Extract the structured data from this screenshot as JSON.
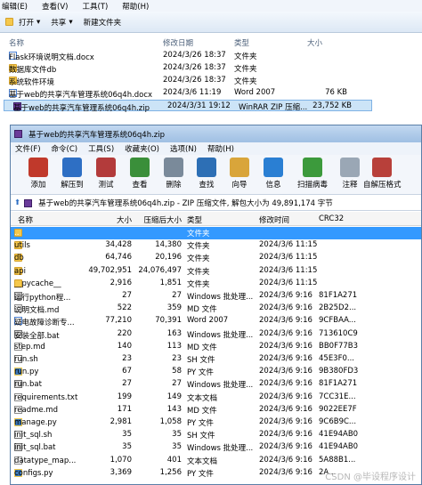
{
  "explorer": {
    "menu": [
      "编辑(E)",
      "查看(V)",
      "工具(T)",
      "帮助(H)"
    ],
    "toolbar": {
      "open": "打开",
      "share": "共享",
      "new_folder": "新建文件夹"
    },
    "columns": {
      "name": "名称",
      "modified": "修改日期",
      "type": "类型",
      "size": "大小"
    },
    "files": [
      {
        "name": "Flask环境说明文档.docx",
        "icon": "doc",
        "modified": "2024/3/26 18:37",
        "type": "文件夹",
        "size": ""
      },
      {
        "name": "数据库文件db",
        "icon": "folder",
        "modified": "2024/3/26 18:37",
        "type": "文件夹",
        "size": ""
      },
      {
        "name": "系统软件环境",
        "icon": "folder",
        "modified": "2024/3/26 18:37",
        "type": "文件夹",
        "size": ""
      },
      {
        "name": "基于web的共享汽车管理系统06q4h.docx",
        "icon": "doc",
        "modified": "2024/3/6 11:19",
        "type": "Word 2007",
        "size": "76 KB"
      },
      {
        "name": "基于web的共享汽车管理系统06q4h.zip",
        "icon": "zip",
        "modified": "2024/3/31 19:12",
        "type": "WinRAR ZIP 压缩...",
        "size": "23,752 KB",
        "selected": true
      }
    ]
  },
  "winrar": {
    "title": "基于web的共享汽车管理系统06q4h.zip",
    "menu": [
      "文件(F)",
      "命令(C)",
      "工具(S)",
      "收藏夹(O)",
      "选项(N)",
      "帮助(H)"
    ],
    "toolbar": [
      {
        "label": "添加",
        "icon": "add-icon",
        "color": "#c0392b"
      },
      {
        "label": "解压到",
        "icon": "extract-icon",
        "color": "#2e6fc4"
      },
      {
        "label": "测试",
        "icon": "test-icon",
        "color": "#b33b3b"
      },
      {
        "label": "查看",
        "icon": "view-icon",
        "color": "#3a8f3a"
      },
      {
        "label": "删除",
        "icon": "delete-icon",
        "color": "#7a8a9a"
      },
      {
        "label": "查找",
        "icon": "find-icon",
        "color": "#2d6fb5"
      },
      {
        "label": "向导",
        "icon": "wizard-icon",
        "color": "#d9a53a"
      },
      {
        "label": "信息",
        "icon": "info-icon",
        "color": "#2a7fd3"
      },
      {
        "label": "扫描病毒",
        "icon": "virus-scan-icon",
        "color": "#3c9a3c"
      },
      {
        "label": "注释",
        "icon": "comment-icon",
        "color": "#9aa7b5"
      },
      {
        "label": "自解压格式",
        "icon": "sfx-icon",
        "color": "#b8403a"
      }
    ],
    "path": "基于web的共享汽车管理系统06q4h.zip - ZIP 压缩文件, 解包大小为 49,891,174 字节",
    "columns": {
      "name": "名称",
      "size": "大小",
      "packed": "压缩后大小",
      "type": "类型",
      "modified": "修改时间",
      "crc": "CRC32"
    },
    "files": [
      {
        "name": "..",
        "icon": "folder",
        "size": "",
        "packed": "",
        "type": "文件夹",
        "modified": "",
        "crc": "",
        "selected": true
      },
      {
        "name": "utils",
        "icon": "folder",
        "size": "34,428",
        "packed": "14,380",
        "type": "文件夹",
        "modified": "2024/3/6 11:15",
        "crc": ""
      },
      {
        "name": "db",
        "icon": "folder",
        "size": "64,746",
        "packed": "20,196",
        "type": "文件夹",
        "modified": "2024/3/6 11:15",
        "crc": ""
      },
      {
        "name": "api",
        "icon": "folder",
        "size": "49,702,951",
        "packed": "24,076,497",
        "type": "文件夹",
        "modified": "2024/3/6 11:15",
        "crc": ""
      },
      {
        "name": "__pycache__",
        "icon": "folder",
        "size": "2,916",
        "packed": "1,851",
        "type": "文件夹",
        "modified": "2024/3/6 11:15",
        "crc": ""
      },
      {
        "name": "运行python程...",
        "icon": "bat",
        "size": "27",
        "packed": "27",
        "type": "Windows 批处理...",
        "modified": "2024/3/6 9:16",
        "crc": "81F1A271"
      },
      {
        "name": "说明文档.md",
        "icon": "txt",
        "size": "522",
        "packed": "359",
        "type": "MD 文件",
        "modified": "2024/3/6 9:16",
        "crc": "2B25D2..."
      },
      {
        "name": "疑电故障诊断专...",
        "icon": "doc",
        "size": "77,210",
        "packed": "70,391",
        "type": "Word 2007",
        "modified": "2024/3/6 9:16",
        "crc": "9CFBAA..."
      },
      {
        "name": "安装全部.bat",
        "icon": "bat",
        "size": "220",
        "packed": "163",
        "type": "Windows 批处理...",
        "modified": "2024/3/6 9:16",
        "crc": "713610C9"
      },
      {
        "name": "step.md",
        "icon": "txt",
        "size": "140",
        "packed": "113",
        "type": "MD 文件",
        "modified": "2024/3/6 9:16",
        "crc": "BB0F77B3"
      },
      {
        "name": "run.sh",
        "icon": "sh",
        "size": "23",
        "packed": "23",
        "type": "SH 文件",
        "modified": "2024/3/6 9:16",
        "crc": "45E3F0..."
      },
      {
        "name": "run.py",
        "icon": "py",
        "size": "67",
        "packed": "58",
        "type": "PY 文件",
        "modified": "2024/3/6 9:16",
        "crc": "9B380FD3"
      },
      {
        "name": "run.bat",
        "icon": "bat",
        "size": "27",
        "packed": "27",
        "type": "Windows 批处理...",
        "modified": "2024/3/6 9:16",
        "crc": "81F1A271"
      },
      {
        "name": "requirements.txt",
        "icon": "txt",
        "size": "199",
        "packed": "149",
        "type": "文本文档",
        "modified": "2024/3/6 9:16",
        "crc": "7CC31E..."
      },
      {
        "name": "readme.md",
        "icon": "txt",
        "size": "171",
        "packed": "143",
        "type": "MD 文件",
        "modified": "2024/3/6 9:16",
        "crc": "9022EE7F"
      },
      {
        "name": "manage.py",
        "icon": "py",
        "size": "2,981",
        "packed": "1,058",
        "type": "PY 文件",
        "modified": "2024/3/6 9:16",
        "crc": "9C6B9C..."
      },
      {
        "name": "init_sql.sh",
        "icon": "sh",
        "size": "35",
        "packed": "35",
        "type": "SH 文件",
        "modified": "2024/3/6 9:16",
        "crc": "41E94AB0"
      },
      {
        "name": "init_sql.bat",
        "icon": "bat",
        "size": "35",
        "packed": "35",
        "type": "Windows 批处理...",
        "modified": "2024/3/6 9:16",
        "crc": "41E94AB0"
      },
      {
        "name": "datatype_map...",
        "icon": "txt",
        "size": "1,070",
        "packed": "401",
        "type": "文本文档",
        "modified": "2024/3/6 9:16",
        "crc": "5A88B1..."
      },
      {
        "name": "configs.py",
        "icon": "py",
        "size": "3,369",
        "packed": "1,256",
        "type": "PY 文件",
        "modified": "2024/3/6 9:16",
        "crc": "2A..."
      }
    ],
    "watermark": "CSDN @毕设程序设计"
  }
}
